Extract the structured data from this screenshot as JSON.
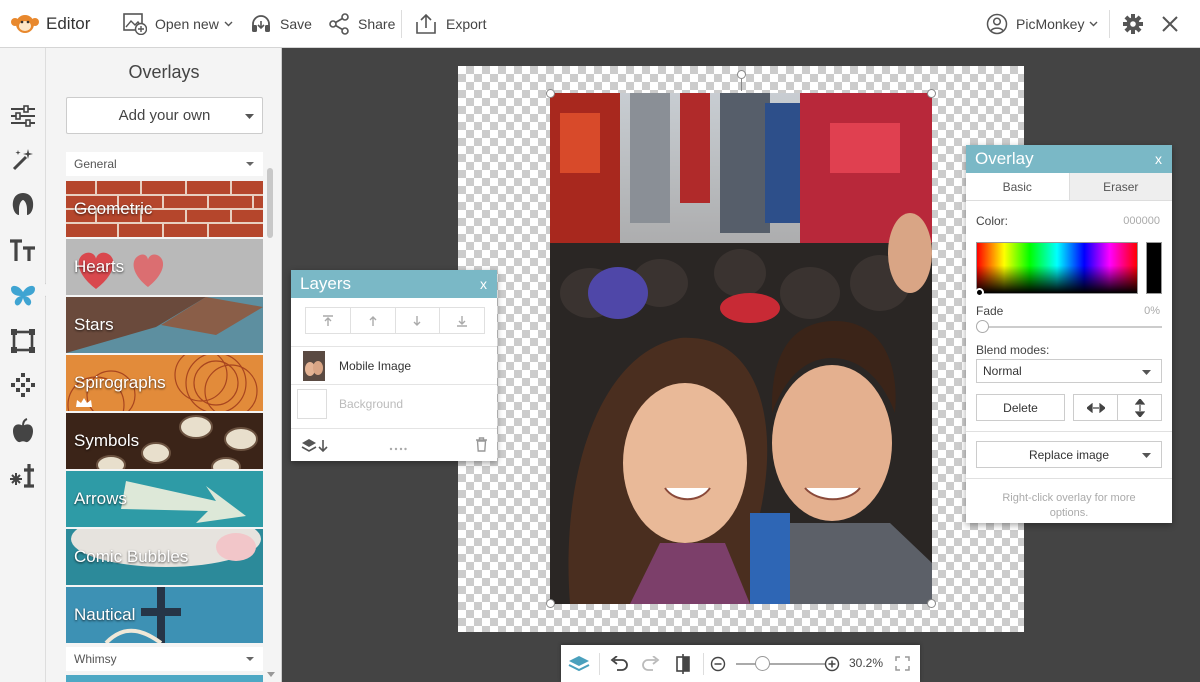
{
  "app": {
    "title": "Editor"
  },
  "toolbar": {
    "open_new": "Open new",
    "save": "Save",
    "share": "Share",
    "export": "Export",
    "account": "PicMonkey"
  },
  "panel": {
    "title": "Overlays",
    "add_own": "Add your own",
    "categories": [
      "General",
      "Whimsy"
    ],
    "tiles": [
      {
        "name": "Geometric",
        "bg": "#b5462c"
      },
      {
        "name": "Hearts",
        "bg": "#b9b9b9"
      },
      {
        "name": "Stars",
        "bg": "#5d8fa0"
      },
      {
        "name": "Spirographs",
        "bg": "#e28b3a"
      },
      {
        "name": "Symbols",
        "bg": "#3b2418"
      },
      {
        "name": "Arrows",
        "bg": "#2e9ba6"
      },
      {
        "name": "Comic Bubbles",
        "bg": "#2c8a9a"
      },
      {
        "name": "Nautical",
        "bg": "#3d91b4"
      }
    ]
  },
  "layers": {
    "title": "Layers",
    "close": "x",
    "items": [
      {
        "name": "Mobile Image"
      },
      {
        "name": "Background"
      }
    ]
  },
  "overlay": {
    "title": "Overlay",
    "close": "x",
    "tabs": [
      "Basic",
      "Eraser"
    ],
    "color_label": "Color:",
    "color_value": "000000",
    "fade_label": "Fade",
    "fade_value": "0%",
    "blend_label": "Blend modes:",
    "blend_value": "Normal",
    "delete_label": "Delete",
    "replace_label": "Replace image",
    "hint": "Right-click overlay for more options."
  },
  "zoom": {
    "value": "30.2%",
    "level": 0.3
  },
  "colors": {
    "accent": "#7ab8c6",
    "logo": "#e8882d"
  }
}
